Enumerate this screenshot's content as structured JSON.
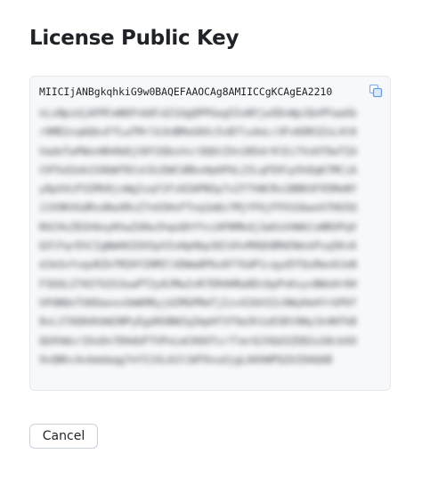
{
  "dialog": {
    "title": "License Public Key",
    "key": {
      "first_line": "MIICIjANBgkqhkiG9w0BAQEFAAOCAg8AMIICCgKCAgEA2210",
      "obscured_text": "nLsNpzdjAFMlmN6Fnb8ld21UgQPPGeg5IoNYjw5DvWpJQnPFaaXbr0MD2vqAQkxFfLwTMrlk3nBMoG0Xc5vB7lu4eLr3FvKDR3ZsL4t0VadeTwPWonNhHb8jS8f2QbsVsr3QQtZXn1N5dr9lEi7VsH7OwTZdCHTkd2eb1S0bWfDCoC6iEWCUBbvHp6PUL2ILqFE0lp5hQqK7MCiAy8pX4iP3IMV0jvWgIzqY1Fz0ZAPNSp7xZf7hNCRx1BBKXF95MeNYJJX9KVGdRsd0wXRsZ7nG5HxFTnq1m8z7MjYF6jFFO1GbwnhTHG5QRGCHsZEGh6oyKhwZd0wJhqoQhYYsiAP8Mkdj3aOsX4WkCoNRXPqVQ3lFqrEhCIgNmHUI6XSpVIoHpHbp3QlUVvM9QhBMd5WskPsq5Kv6dJm3vYsqoRZkfM2HfZHMIlXDWa8P6x8f7GdP1cqyd5TQsRmx0JeNF3UULZ7A57U2S3uwPT2y8JMw2vR7ER4HRa8Di6pPxKsyvBWsHr6HhPdNQnTGKDaoxvUmW9Ryjd2MGPRmTjIzvX2bh5Zc0WyKm4YrGP0f8vL1TAQ0dhbW2NPyEgd0GBWZqZmpHf3f9a3h1oD3Dt0Wy1k4KFkBQUXhWzrIOxDn7DHdUFTVPoLmCK6OTsr7lmrQJXQd3ZEB2uS8cbXO9vQNhcAvbmdaqg7eYI1XLA2t1WT0xuUjgLA0XWPQ2bIDAQAB"
    },
    "icons": {
      "copy": "copy-icon"
    },
    "buttons": {
      "cancel_label": "Cancel"
    }
  }
}
